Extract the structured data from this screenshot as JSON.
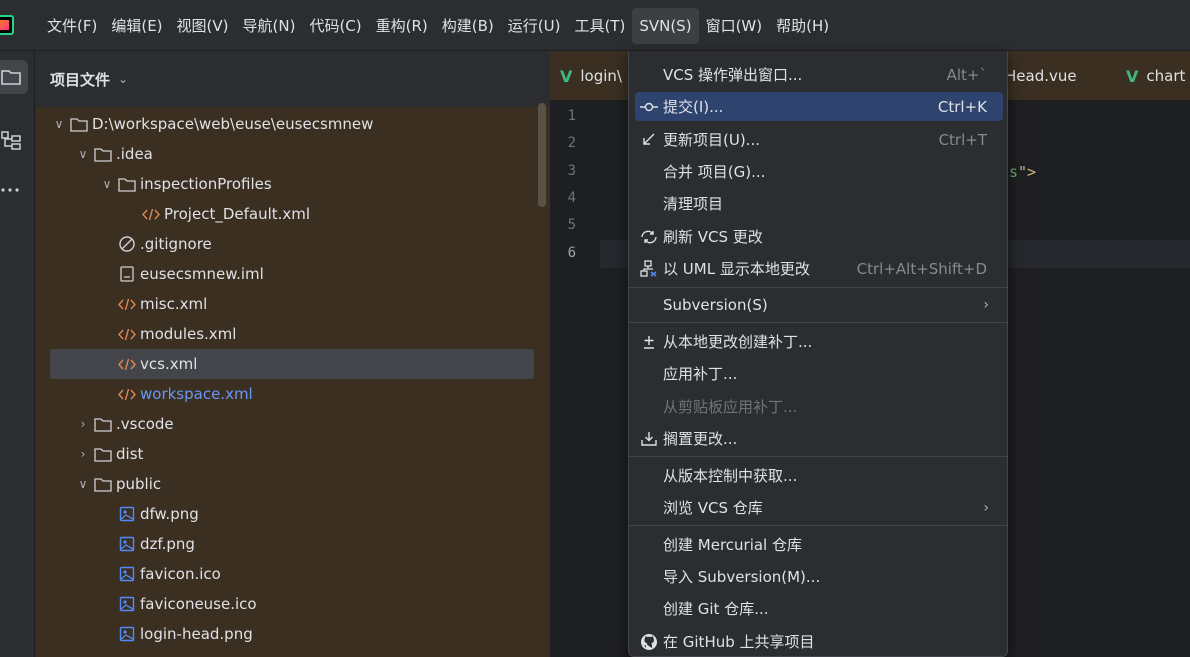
{
  "menubar": {
    "items": [
      {
        "label": "文件(F)"
      },
      {
        "label": "编辑(E)"
      },
      {
        "label": "视图(V)"
      },
      {
        "label": "导航(N)"
      },
      {
        "label": "代码(C)"
      },
      {
        "label": "重构(R)"
      },
      {
        "label": "构建(B)"
      },
      {
        "label": "运行(U)"
      },
      {
        "label": "工具(T)"
      },
      {
        "label": "SVN(S)"
      },
      {
        "label": "窗口(W)"
      },
      {
        "label": "帮助(H)"
      }
    ],
    "active_index": 9
  },
  "project_panel": {
    "title": "项目文件",
    "tree": [
      {
        "label": "D:\\workspace\\web\\euse\\eusecsmnew",
        "type": "folder",
        "expanded": true
      },
      {
        "label": ".idea",
        "type": "folder",
        "expanded": true
      },
      {
        "label": "inspectionProfiles",
        "type": "folder",
        "expanded": true
      },
      {
        "label": "Project_Default.xml",
        "type": "xml"
      },
      {
        "label": ".gitignore",
        "type": "ignore"
      },
      {
        "label": "eusecsmnew.iml",
        "type": "iml"
      },
      {
        "label": "misc.xml",
        "type": "xml"
      },
      {
        "label": "modules.xml",
        "type": "xml"
      },
      {
        "label": "vcs.xml",
        "type": "xml",
        "selected": true
      },
      {
        "label": "workspace.xml",
        "type": "xml",
        "modified": true
      },
      {
        "label": ".vscode",
        "type": "folder",
        "expanded": false
      },
      {
        "label": "dist",
        "type": "folder",
        "expanded": false
      },
      {
        "label": "public",
        "type": "folder",
        "expanded": true
      },
      {
        "label": "dfw.png",
        "type": "image"
      },
      {
        "label": "dzf.png",
        "type": "image"
      },
      {
        "label": "favicon.ico",
        "type": "image"
      },
      {
        "label": "faviconeuse.ico",
        "type": "image"
      },
      {
        "label": "login-head.png",
        "type": "image"
      }
    ]
  },
  "editor": {
    "tabs": [
      {
        "label": "login\\"
      },
      {
        "label": "Head.vue"
      },
      {
        "label": "chart"
      }
    ],
    "line_numbers": [
      "1",
      "2",
      "3",
      "4",
      "5",
      "6"
    ],
    "current_line": "6",
    "code_fragment_text": "s",
    "code_fragment_tag": "\">"
  },
  "svn_menu": {
    "items": [
      {
        "label": "VCS 操作弹出窗口...",
        "shortcut": "Alt+`",
        "icon": ""
      },
      {
        "label": "提交(I)...",
        "shortcut": "Ctrl+K",
        "icon": "commit-icon",
        "highlighted": true
      },
      {
        "label": "更新项目(U)...",
        "shortcut": "Ctrl+T",
        "icon": "update-arrow-icon"
      },
      {
        "label": "合并 项目(G)...",
        "shortcut": "",
        "icon": ""
      },
      {
        "label": "清理项目",
        "shortcut": "",
        "icon": ""
      },
      {
        "label": "刷新 VCS 更改",
        "shortcut": "",
        "icon": "refresh-icon"
      },
      {
        "label": "以 UML 显示本地更改",
        "shortcut": "Ctrl+Alt+Shift+D",
        "icon": "uml-diagram-icon"
      },
      {
        "label": "Subversion(S)",
        "submenu": true
      },
      {
        "label": "从本地更改创建补丁...",
        "icon": "patch-icon"
      },
      {
        "label": "应用补丁..."
      },
      {
        "label": "从剪贴板应用补丁...",
        "disabled": true
      },
      {
        "label": "搁置更改...",
        "icon": "shelve-icon"
      },
      {
        "label": "从版本控制中获取..."
      },
      {
        "label": "浏览 VCS 仓库",
        "submenu": true
      },
      {
        "label": "创建 Mercurial 仓库"
      },
      {
        "label": "导入 Subversion(M)..."
      },
      {
        "label": "创建 Git 仓库..."
      },
      {
        "label": "在 GitHub 上共享项目",
        "icon": "github-icon"
      }
    ]
  },
  "colors": {
    "menu_highlight": "#2e436e",
    "project_bg": "#3b2f22",
    "modified_file": "#6897f5",
    "vue_green": "#41b883"
  }
}
